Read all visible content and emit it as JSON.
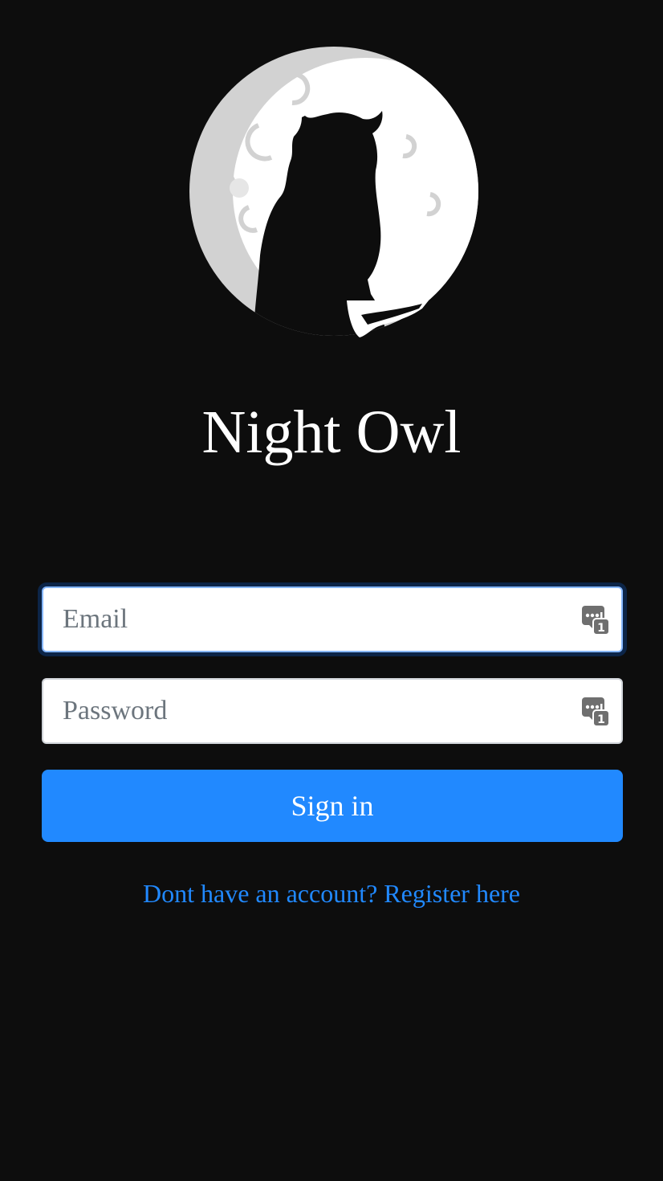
{
  "app": {
    "title": "Night Owl"
  },
  "form": {
    "email": {
      "placeholder": "Email",
      "value": ""
    },
    "password": {
      "placeholder": "Password",
      "value": ""
    },
    "signin_label": "Sign in",
    "register_text": "Dont have an account? Register here"
  },
  "icons": {
    "logo": "owl-moon-logo",
    "field_icon": "password-manager-icon"
  },
  "colors": {
    "background": "#0d0d0d",
    "accent": "#2189ff",
    "title_text": "#ffffff",
    "focus_ring": "#86b7fe"
  }
}
